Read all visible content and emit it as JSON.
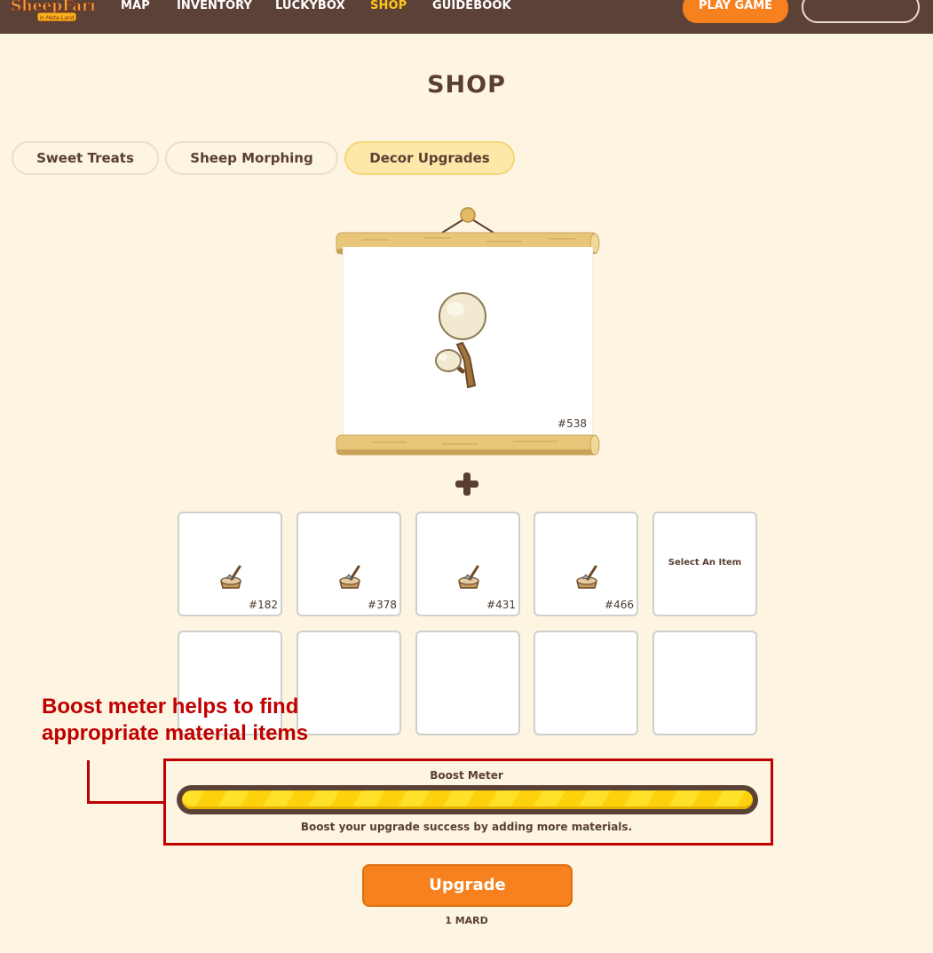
{
  "nav": {
    "logo_text": "SheepFarm",
    "logo_subtext": "in Meta-Land",
    "links": [
      "MAP",
      "INVENTORY",
      "LUCKYBOX",
      "SHOP",
      "GUIDEBOOK"
    ],
    "active_link": "SHOP",
    "play_button": "PLAY GAME"
  },
  "page": {
    "title": "SHOP"
  },
  "tabs": [
    {
      "label": "Sweet Treats",
      "active": false
    },
    {
      "label": "Sheep Morphing",
      "active": false
    },
    {
      "label": "Decor Upgrades",
      "active": true
    }
  ],
  "main_item": {
    "id": "#538",
    "icon": "tree-icon"
  },
  "material_slots": [
    {
      "id": "#182",
      "icon": "axe-stump-icon"
    },
    {
      "id": "#378",
      "icon": "axe-stump-icon"
    },
    {
      "id": "#431",
      "icon": "axe-stump-icon"
    },
    {
      "id": "#466",
      "icon": "axe-stump-icon"
    },
    {
      "label": "Select An Item"
    },
    {},
    {},
    {},
    {},
    {}
  ],
  "annotation": {
    "line1": "Boost meter helps to find",
    "line2": "appropriate material items"
  },
  "boost": {
    "label": "Boost Meter",
    "level": 1.0,
    "description": "Boost your upgrade success by adding more materials."
  },
  "upgrade": {
    "button_label": "Upgrade",
    "price": "1 MARD"
  },
  "colors": {
    "background": "#fdf5e1",
    "navbar": "#5c4236",
    "accent_orange": "#f7811e",
    "active_nav": "#ffc61a",
    "annotation_red": "#c00000"
  }
}
